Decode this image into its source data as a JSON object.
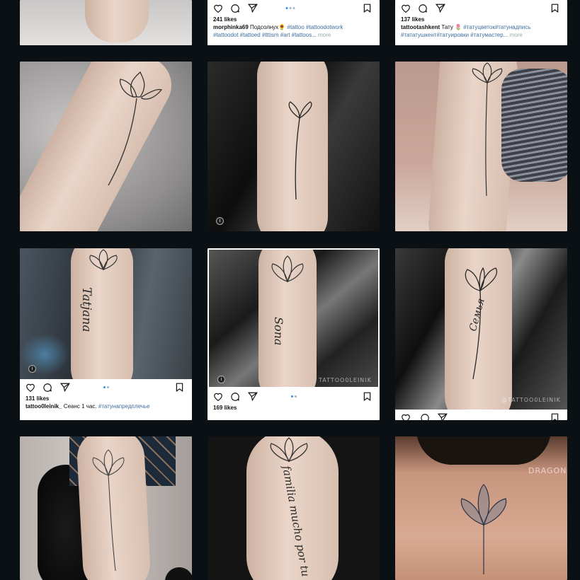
{
  "posts": {
    "p2": {
      "likes": "241 likes",
      "user": "morphinka69",
      "caption_text": " Подсолнух",
      "emoji": "🌻",
      "tags1": " #tattoo  #tattoodotwork",
      "tags2": "#tattoodot #tattoed #tttism  #art",
      "tags3": " #tattoos...",
      "more": " more"
    },
    "p3": {
      "likes": "137 likes",
      "user": "tattootashkent",
      "caption_text": " Тату ",
      "emoji": "🌷",
      "tags1": " #татуцветок#татунадпись",
      "tags2": "#тататушкент#татуировки #татумастер...",
      "more": " more"
    },
    "p7": {
      "likes": "131 likes",
      "user": "tattoo0leinik_",
      "caption_text": " Сеанс 1 час.",
      "tags1": " #татунапредплечье"
    },
    "p8": {
      "likes": "169 likes"
    }
  },
  "tattoo_text": {
    "p7": "Tatjana",
    "p8": "Sona",
    "p9": "Семья",
    "p11": "familia mucho por tu"
  },
  "watermarks": {
    "p8": "TATTOO0LEINIK",
    "p9": "@TATTOO0LEINIK",
    "p12": "DRAGON"
  },
  "icons": [
    "heart-icon",
    "comment-icon",
    "share-icon",
    "bookmark-icon",
    "info-icon"
  ],
  "colors": {
    "background": "#0b1015",
    "accent": "#2d8ef0",
    "hashtag": "#3d6ea0"
  }
}
